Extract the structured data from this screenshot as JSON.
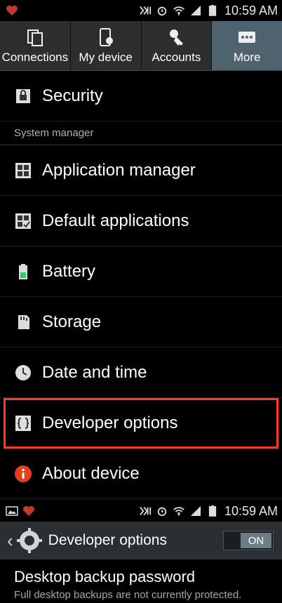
{
  "status_bar_top": {
    "time": "10:59 AM"
  },
  "tabs": [
    {
      "label": "Connections",
      "icon": "connections-icon"
    },
    {
      "label": "My device",
      "icon": "my-device-icon"
    },
    {
      "label": "Accounts",
      "icon": "accounts-icon"
    },
    {
      "label": "More",
      "icon": "more-icon",
      "selected": true
    }
  ],
  "list": {
    "security": "Security",
    "section_header": "System manager",
    "items": [
      {
        "label": "Application manager",
        "icon": "grid-icon"
      },
      {
        "label": "Default applications",
        "icon": "default-apps-icon"
      },
      {
        "label": "Battery",
        "icon": "battery-icon"
      },
      {
        "label": "Storage",
        "icon": "storage-icon"
      },
      {
        "label": "Date and time",
        "icon": "clock-icon"
      },
      {
        "label": "Developer options",
        "icon": "braces-icon",
        "highlighted": true
      },
      {
        "label": "About device",
        "icon": "info-icon"
      }
    ]
  },
  "status_bar_bottom": {
    "time": "10:59 AM"
  },
  "dev_bar": {
    "title": "Developer options",
    "toggle_label": "ON"
  },
  "setting": {
    "title": "Desktop backup password",
    "subtitle": "Full desktop backups are not currently protected."
  },
  "colors": {
    "highlight": "#ff3b1f",
    "tab_selected": "#4e636d",
    "toggle_on": "#6b7e86"
  }
}
